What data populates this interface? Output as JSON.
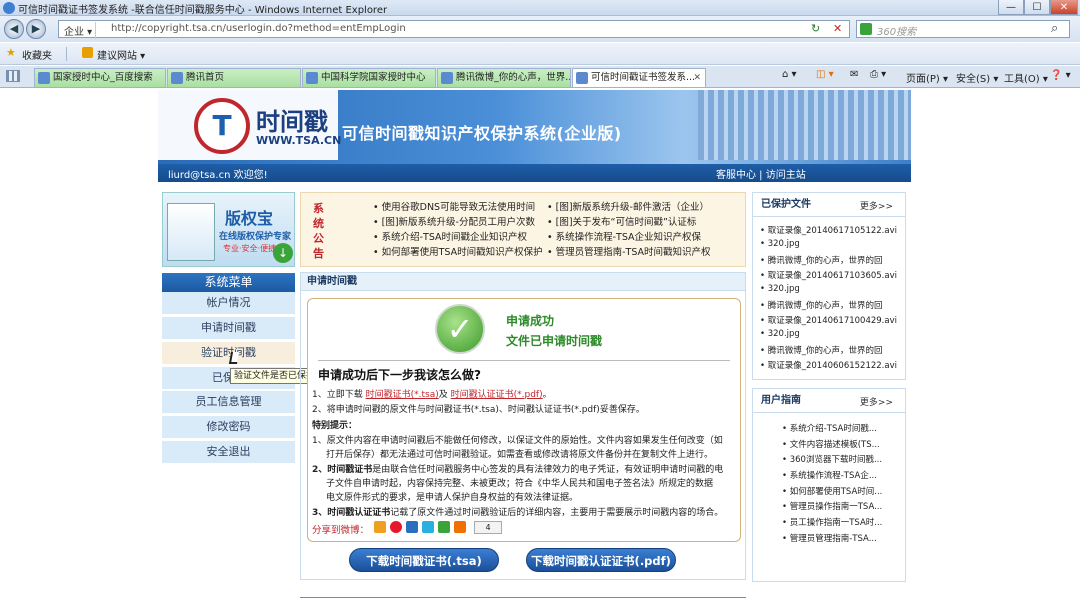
{
  "window": {
    "title": "可信时间戳证书签发系统 -联合信任时间戳服务中心 - Windows Internet Explorer",
    "back_glyph": "◀",
    "forward_glyph": "▶",
    "minimize_glyph": "—",
    "maximize_glyph": "☐",
    "close_glyph": "✕"
  },
  "address_bar": {
    "zone": "企业 ▾",
    "url": "http://copyright.tsa.cn/userlogin.do?method=entEmpLogin",
    "search_placeholder": "360搜索",
    "refresh_glyph": "↻",
    "stop_glyph": "✕",
    "search_glyph": "⌕"
  },
  "favorites_bar": {
    "favorites_label": "收藏夹",
    "suggested_label": "建议网站 ▾",
    "star_glyph": "★"
  },
  "tabs": [
    {
      "label": "国家授时中心_百度搜索"
    },
    {
      "label": "腾讯首页"
    },
    {
      "label": "中国科学院国家授时中心"
    },
    {
      "label": "腾讯微博_你的心声，世界..."
    },
    {
      "label": "可信时间戳证书签发系..."
    }
  ],
  "command_bar": {
    "page": "页面(P) ▾",
    "safety": "安全(S) ▾",
    "tools": "工具(O) ▾",
    "help": "❓ ▾",
    "home": "⌂ ▾",
    "rss": "◫ ▾",
    "mail": "✉",
    "print": "⎙ ▾",
    "tab_close": "✕"
  },
  "banner": {
    "logo_glyph": "T",
    "brand": "时间戳",
    "brand_site": "WWW.TSA.CN",
    "system_title": "可信时间戳知识产权保护系统(企业版)",
    "welcome": "liurd@tsa.cn 欢迎您!",
    "links": "客服中心  |  访问主站"
  },
  "promo": {
    "title": "版权宝",
    "subtitle": "在线版权保护专家",
    "tags": "专业·安全·便捷",
    "download_glyph": "↓"
  },
  "menu": {
    "title": "系统菜单",
    "items": [
      "帐户情况",
      "申请时间戳",
      "验证时间戳",
      "已保护",
      "员工信息管理",
      "修改密码",
      "安全退出"
    ],
    "tooltip": "验证文件是否已保护"
  },
  "notice": {
    "label": "系统公告",
    "left": [
      "• 使用谷歌DNS可能导致无法使用时间",
      "• [图]新版系统升级-分配员工用户次数",
      "• 系统介绍-TSA时间戳企业知识产权",
      "• 如何部署使用TSA时间戳知识产权保护"
    ],
    "right": [
      "• [图]新版系统升级-邮件激活（企业）",
      "• [图]关于发布“可信时间戳”认证标",
      "• 系统操作流程-TSA企业知识产权保",
      "• 管理员管理指南-TSA时间戳知识产权"
    ]
  },
  "apply": {
    "header": "申请时间戳",
    "check_glyph": "✓",
    "success1": "申请成功",
    "success2": "文件已申请时间戳",
    "next_title": "申请成功后下一步我该怎么做?",
    "step1_prefix": "1、立即下载",
    "step1_link1": "时间戳证书(*.tsa)",
    "step1_mid": "及",
    "step1_link2": "时间戳认证证书(*.pdf)",
    "step1_suffix": "。",
    "step2": "2、将申请时间戳的原文件与时间戳证书(*.tsa)、时间戳认证证书(*.pdf)妥善保存。",
    "special": "特别提示：",
    "tip1a": "1、原文件内容在申请时间戳后不能做任何修改，以保证文件的原始性。文件内容如果发生任何改变（如",
    "tip1b": "打开后保存）都无法通过可信时间戳验证。如需查看或修改请将原文件备份并在复制文件上进行。",
    "tip2a_bold": "2、时间戳证书",
    "tip2a": "是由联合信任时间戳服务中心签发的具有法律效力的电子凭证，有效证明申请时间戳的电",
    "tip2b": "子文件自申请时起，内容保持完整、未被更改；符合《中华人民共和国电子签名法》所规定的数据",
    "tip2c": "电文原件形式的要求，是申请人保护自身权益的有效法律证据。",
    "tip3_bold": "3、时间戳认证证书",
    "tip3": "记载了原文件通过时间戳验证后的详细内容，主要用于需要展示时间戳内容的场合。",
    "share": "分享到微博：",
    "share_count": "4",
    "btn_tsa": "下载时间戳证书(.tsa)",
    "btn_pdf": "下载时间戳认证证书(.pdf)"
  },
  "protected": {
    "title": "已保护文件",
    "more": "更多>>",
    "items": [
      "• 取证录像_20140617105122.avi",
      "• 320.jpg",
      "• 腾讯微博_你的心声，世界的回",
      "• 取证录像_20140617103605.avi",
      "• 320.jpg",
      "• 腾讯微博_你的心声，世界的回",
      "• 取证录像_20140617100429.avi",
      "• 320.jpg",
      "• 腾讯微博_你的心声，世界的回",
      "• 取证录像_20140606152122.avi"
    ]
  },
  "guide": {
    "title": "用户指南",
    "more": "更多>>",
    "items": [
      "• 系统介绍-TSA时间戳...",
      "• 文件内容描述模板(TS...",
      "• 360浏览器下载时间戳...",
      "• 系统操作流程-TSA企...",
      "• 如何部署使用TSA时间...",
      "• 管理员操作指南一TSA...",
      "• 员工操作指南一TSA时...",
      "• 管理员管理指南-TSA..."
    ]
  },
  "colors": {
    "brand_blue": "#1e5ea8",
    "success_green": "#2d8a2a",
    "alert_red": "#c0272d"
  }
}
